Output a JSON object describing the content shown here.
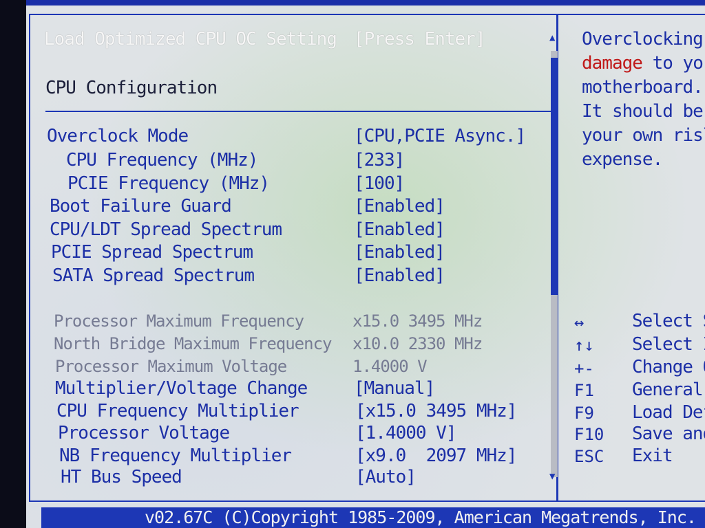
{
  "top_item": {
    "label": "Load Optimized CPU OC Setting",
    "value": "[Press Enter]"
  },
  "section_title": "CPU Configuration",
  "settings": [
    {
      "label": "Overclock Mode",
      "value": "[CPU,PCIE Async.]"
    },
    {
      "label": "CPU Frequency (MHz)",
      "value": "[233]"
    },
    {
      "label": "PCIE Frequency (MHz)",
      "value": "[100]"
    },
    {
      "label": "Boot Failure Guard",
      "value": "[Enabled]"
    },
    {
      "label": "CPU/LDT Spread Spectrum",
      "value": "[Enabled]"
    },
    {
      "label": "PCIE Spread Spectrum",
      "value": "[Enabled]"
    },
    {
      "label": "SATA Spread Spectrum",
      "value": "[Enabled]"
    }
  ],
  "info": [
    {
      "label": "Processor Maximum Frequency",
      "value": "x15.0 3495 MHz"
    },
    {
      "label": "North Bridge Maximum Frequency",
      "value": "x10.0 2330 MHz"
    },
    {
      "label": "Processor Maximum Voltage",
      "value": "1.4000 V"
    }
  ],
  "settings2": [
    {
      "label": "Multiplier/Voltage Change",
      "value": "[Manual]"
    },
    {
      "label": "CPU Frequency Multiplier",
      "value": "[x15.0 3495 MHz]"
    },
    {
      "label": "Processor Voltage",
      "value": "[1.4000 V]"
    },
    {
      "label": "NB Frequency Multiplier",
      "value": "[x9.0  2097 MHz]"
    },
    {
      "label": "HT Bus Speed",
      "value": "[Auto]"
    }
  ],
  "help": {
    "line1": "Overclocking",
    "line2_red": "damage",
    "line2_rest": " to yo",
    "line3": "motherboard.",
    "line4": "It should be",
    "line5": "your own risl",
    "line6": "expense."
  },
  "keys": [
    {
      "key": "↔",
      "desc": "Select S"
    },
    {
      "key": "↑↓",
      "desc": "Select I"
    },
    {
      "key": "+-",
      "desc": "Change O"
    },
    {
      "key": "F1",
      "desc": "General"
    },
    {
      "key": "F9",
      "desc": "Load Def"
    },
    {
      "key": "F10",
      "desc": "Save and"
    },
    {
      "key": "ESC",
      "desc": "Exit"
    }
  ],
  "footer": "v02.67C (C)Copyright 1985-2009, American Megatrends, Inc."
}
